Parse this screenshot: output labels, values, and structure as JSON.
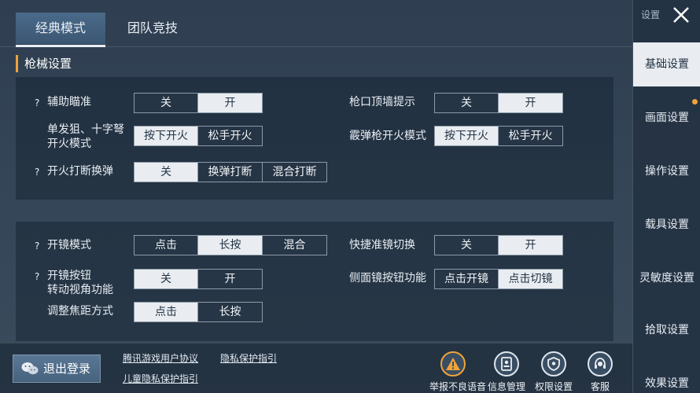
{
  "tabs": [
    {
      "label": "经典模式"
    },
    {
      "label": "团队竞技"
    }
  ],
  "section_title": "枪械设置",
  "panel1": {
    "left": [
      {
        "label": "辅助瞄准",
        "help": "?",
        "options": [
          "关",
          "开"
        ]
      },
      {
        "label_line1": "单发狙、十字弩",
        "label_line2": "开火模式",
        "options": [
          "按下开火",
          "松手开火"
        ]
      },
      {
        "label": "开火打断换弹",
        "help": "?",
        "options": [
          "关",
          "换弹打断",
          "混合打断"
        ]
      }
    ],
    "right": [
      {
        "label": "枪口顶墙提示",
        "options": [
          "关",
          "开"
        ]
      },
      {
        "label": "霰弹枪开火模式",
        "options": [
          "按下开火",
          "松手开火"
        ]
      }
    ]
  },
  "panel2": {
    "left": [
      {
        "label": "开镜模式",
        "help": "?",
        "options": [
          "点击",
          "长按",
          "混合"
        ]
      },
      {
        "label_line1": "开镜按钮",
        "label_line2": "转动视角功能",
        "help": "?",
        "options": [
          "关",
          "开"
        ]
      },
      {
        "label": "调整焦距方式",
        "options": [
          "点击",
          "长按"
        ]
      }
    ],
    "right": [
      {
        "label": "快捷准镜切换",
        "options": [
          "关",
          "开"
        ]
      },
      {
        "label": "侧面镜按钮功能",
        "options": [
          "点击开镜",
          "点击切镜"
        ]
      }
    ]
  },
  "sidebar": {
    "header": "设置",
    "items": [
      {
        "label": "基础设置"
      },
      {
        "label": "画面设置"
      },
      {
        "label": "操作设置"
      },
      {
        "label": "载具设置"
      },
      {
        "label": "灵敏度设置"
      },
      {
        "label": "拾取设置"
      },
      {
        "label": "效果设置"
      }
    ]
  },
  "footer": {
    "logout": "退出登录",
    "links": [
      "腾讯游戏用户协议",
      "隐私保护指引",
      "儿童隐私保护指引"
    ],
    "buttons": [
      {
        "label": "举报不良语音",
        "icon": "warning-icon"
      },
      {
        "label": "信息管理",
        "icon": "id-card-icon"
      },
      {
        "label": "权限设置",
        "icon": "shield-icon"
      },
      {
        "label": "客服",
        "icon": "headset-icon"
      }
    ]
  },
  "colors": {
    "accent": "#f0a33a",
    "selected": "#e9edf1"
  }
}
